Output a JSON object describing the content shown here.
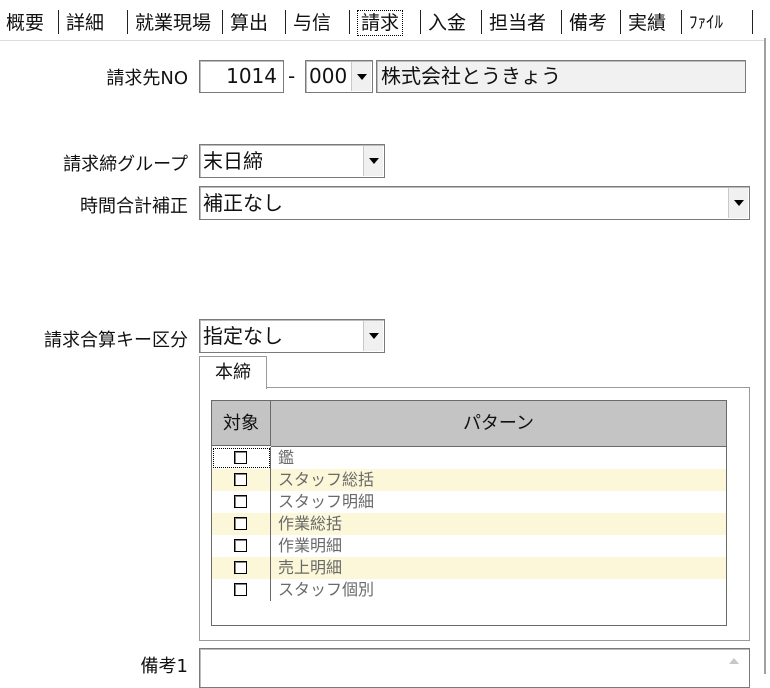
{
  "tabs": [
    "概要",
    "詳細",
    "就業現場",
    "算出",
    "与信",
    "請求",
    "入金",
    "担当者",
    "備考",
    "実績",
    "ﾌｧｲﾙ"
  ],
  "active_tab": "請求",
  "billing": {
    "label": "請求先NO",
    "number": "1014",
    "separator": "-",
    "branch": "000",
    "company_name": "株式会社とうきょう"
  },
  "closing_group": {
    "label": "請求締グループ",
    "value": "末日締"
  },
  "time_correction": {
    "label": "時間合計補正",
    "value": "補正なし"
  },
  "sum_key": {
    "label": "請求合算キー区分",
    "value": "指定なし"
  },
  "inner_tab": "本締",
  "pattern_grid": {
    "headers": [
      "対象",
      "パターン"
    ],
    "rows": [
      {
        "label": "鑑"
      },
      {
        "label": "スタッフ総括"
      },
      {
        "label": "スタッフ明細"
      },
      {
        "label": "作業総括"
      },
      {
        "label": "作業明細"
      },
      {
        "label": "売上明細"
      },
      {
        "label": "スタッフ個別"
      }
    ]
  },
  "remarks1": {
    "label": "備考1",
    "value": ""
  }
}
